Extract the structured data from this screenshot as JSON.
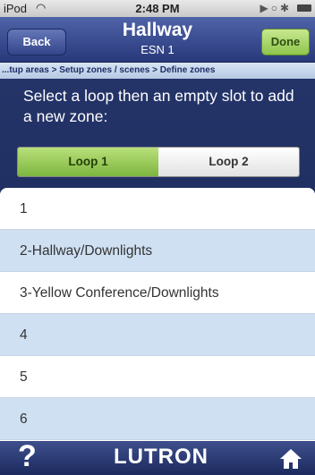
{
  "status_bar": {
    "carrier": "iPod",
    "time": "2:48 PM"
  },
  "nav": {
    "back_label": "Back",
    "title": "Hallway",
    "subtitle": "ESN 1",
    "done_label": "Done"
  },
  "breadcrumb": "...tup areas > Setup zones / scenes > Define zones",
  "instruction": "Select a loop then an empty slot to add a new zone:",
  "loop_tabs": [
    {
      "label": "Loop 1",
      "selected": true
    },
    {
      "label": "Loop 2",
      "selected": false
    }
  ],
  "zones": [
    {
      "label": "1"
    },
    {
      "label": "2-Hallway/Downlights"
    },
    {
      "label": "3-Yellow Conference/Downlights"
    },
    {
      "label": "4"
    },
    {
      "label": "5"
    },
    {
      "label": "6"
    }
  ],
  "footer": {
    "help_label": "?",
    "logo": "LUTRON"
  },
  "colors": {
    "nav_bar": "#34458a",
    "selected_tab": "#8ec44c",
    "alt_row": "#cfe0f3"
  }
}
